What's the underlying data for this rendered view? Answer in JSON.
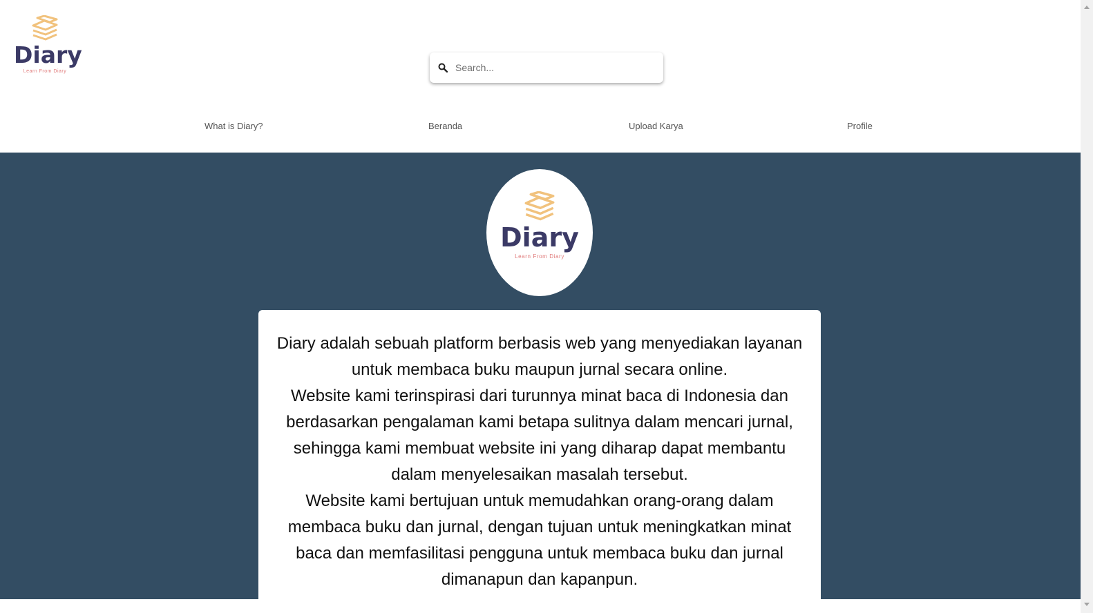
{
  "brand": {
    "name": "Diary",
    "tagline": "Learn From Diary",
    "icon": "stacked-books-icon",
    "colors": {
      "wordmark": "#3b3a66",
      "tagline": "#e07a7a",
      "books": "#f1c27d"
    }
  },
  "search": {
    "placeholder": "Search...",
    "value": "",
    "icon": "search-icon"
  },
  "nav": {
    "items": [
      {
        "label": "What is Diary?"
      },
      {
        "label": "Beranda"
      },
      {
        "label": "Upload Karya"
      },
      {
        "label": "Profile"
      }
    ]
  },
  "hero": {
    "background": "#334d63",
    "logo": {
      "name": "Diary",
      "tagline": "Learn From Diary"
    },
    "about": {
      "paragraphs": [
        "Diary adalah sebuah platform berbasis web yang menyediakan layanan untuk membaca buku maupun jurnal secara online.",
        "Website kami terinspirasi dari turunnya minat baca di Indonesia dan berdasarkan pengalaman kami betapa sulitnya dalam mencari jurnal, sehingga kami membuat website ini yang diharap dapat membantu dalam menyelesaikan masalah tersebut.",
        "Website kami bertujuan untuk memudahkan orang-orang dalam membaca buku dan jurnal, dengan tujuan untuk meningkatkan minat baca dan memfasilitasi pengguna untuk membaca buku dan jurnal dimanapun dan kapanpun."
      ]
    }
  }
}
